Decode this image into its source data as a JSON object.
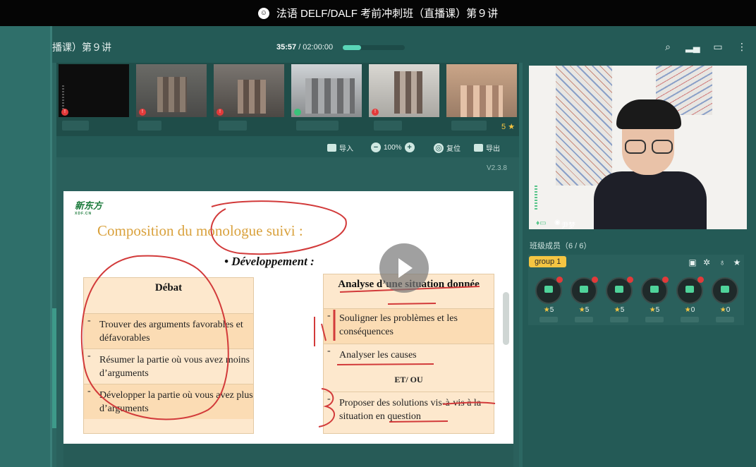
{
  "window": {
    "title": "法语 DELF/DALF 考前冲刺班（直播课）第９讲"
  },
  "header": {
    "title_fragment": "播课）第９讲",
    "elapsed": "35:57",
    "total": " / 02:00:00",
    "progress": 0.3
  },
  "videostrip": {
    "count": "5"
  },
  "toolbar": {
    "import": "导入",
    "zoom": "100%",
    "reset": "复位",
    "export": "导出"
  },
  "doc": {
    "version": "V2.3.8",
    "brand": "新东方",
    "brand_sub": "XDF.CN",
    "title": "Composition du monologue suivi :",
    "subtitle": "• Développement :",
    "left": {
      "header": "Débat",
      "rows": [
        {
          "dash": "-",
          "text": "Trouver des arguments favorables et défavorables"
        },
        {
          "dash": "-",
          "text": "Résumer la partie où vous avez moins d’arguments"
        },
        {
          "dash": "-",
          "text": "Développer la partie où vous avez plus d’arguments"
        }
      ]
    },
    "right": {
      "header": "Analyse d’une situation donnée",
      "rows": [
        {
          "dash": "-",
          "text": "Souligner les problèmes et les conséquences"
        },
        {
          "dash": "-",
          "text": "Analyser les causes"
        },
        {
          "dash": "",
          "text": "ET/ OU"
        },
        {
          "dash": "-",
          "text": "Proposer des solutions vis-à-vis à la situation en question"
        }
      ]
    }
  },
  "teacher": {
    "name": "尹梦"
  },
  "members": {
    "title": "班级成员（6 / 6）",
    "group": "group 1",
    "stars": [
      "5",
      "5",
      "5",
      "5",
      "0",
      "0"
    ]
  }
}
